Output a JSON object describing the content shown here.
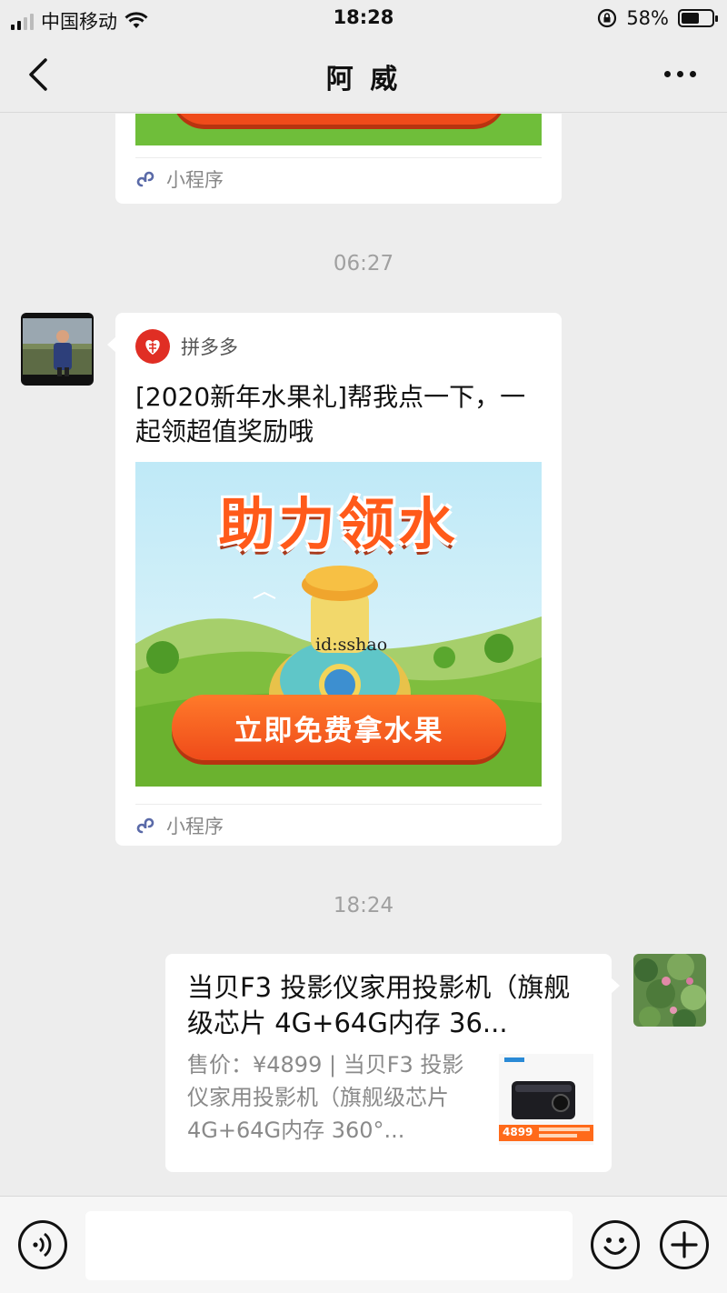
{
  "status_bar": {
    "carrier": "中国移动",
    "time": "18:28",
    "battery": "58%",
    "battery_level": 0.58
  },
  "nav": {
    "title": "阿 威"
  },
  "messages": {
    "prev_card": {
      "footer": "小程序"
    },
    "timestamp1": "06:27",
    "pdd_card": {
      "source": "拼多多",
      "description": "[2020新年水果礼]帮我点一下，一起领超值奖励哦",
      "image_headline": "助力领水",
      "image_button": "立即免费拿水果",
      "watermark": "id:sshao",
      "footer": "小程序"
    },
    "timestamp2": "18:24",
    "product_card": {
      "title": "当贝F3 投影仪家用投影机（旗舰级芯片 4G+64G内存 36...",
      "description": "售价：¥4899 | 当贝F3 投影仪家用投影机（旗舰级芯片 4G+64G内存 360°...",
      "thumb_price": "4899"
    }
  },
  "icons": [
    "back-icon",
    "more-icon",
    "voice-icon",
    "emoji-icon",
    "plus-icon",
    "mini-program-icon",
    "wifi-icon",
    "lock-rotation-icon"
  ]
}
